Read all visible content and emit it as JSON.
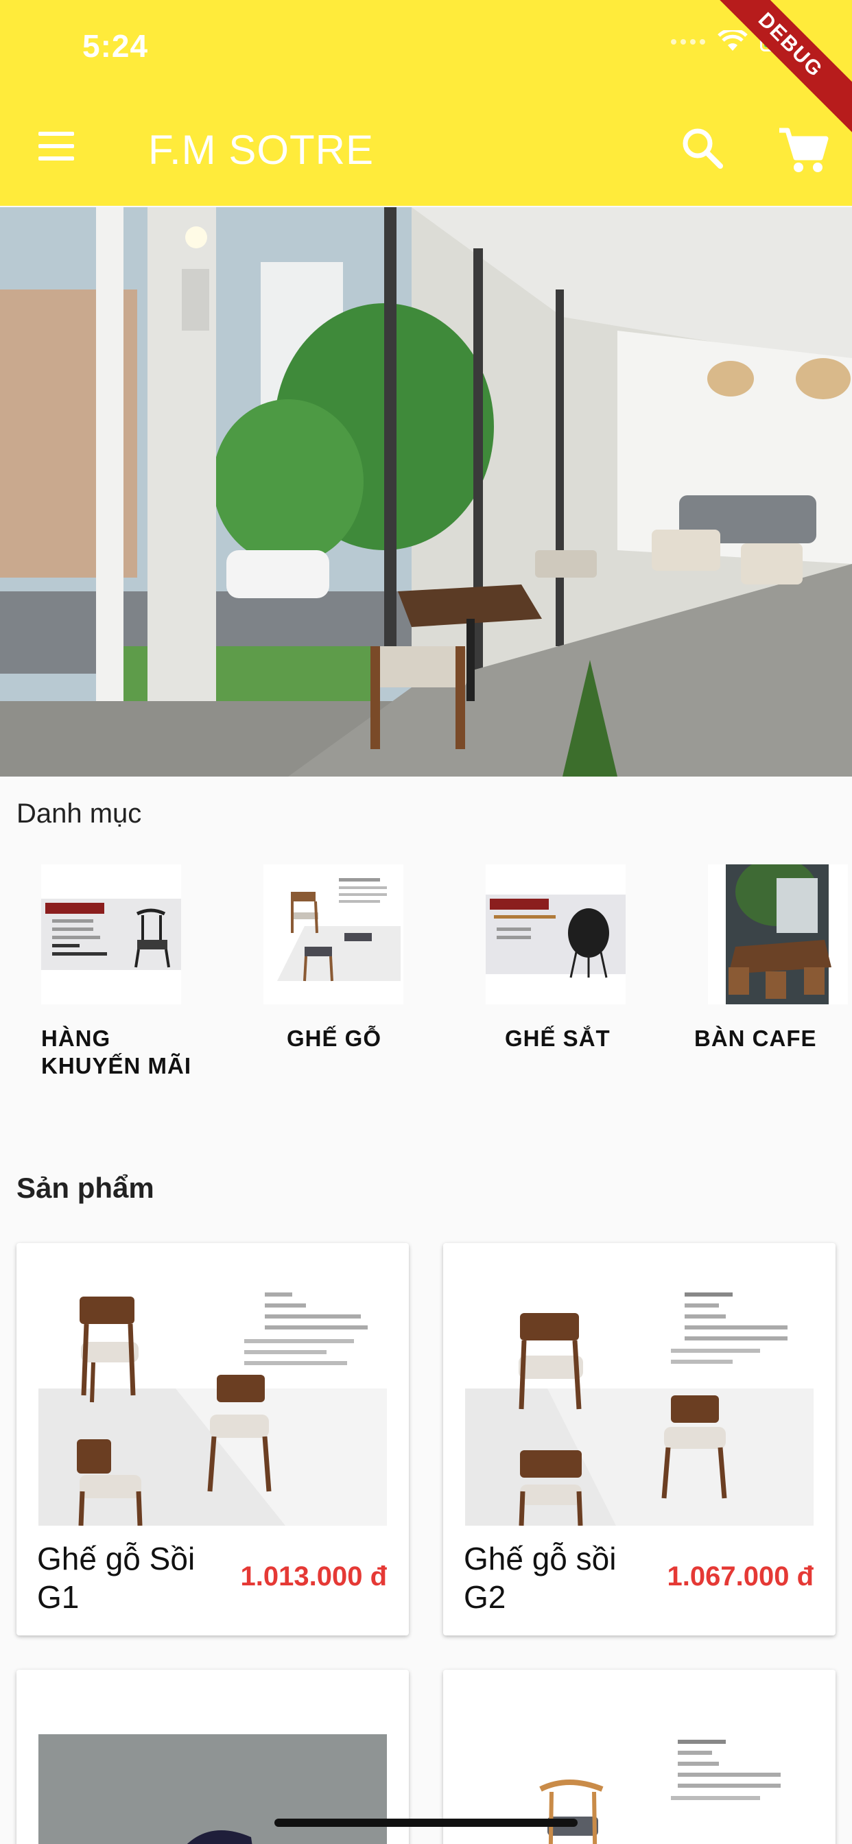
{
  "status_bar": {
    "time": "5:24",
    "debug_label": "DEBUG"
  },
  "appbar": {
    "title": "F.M SOTRE"
  },
  "sections": {
    "categories_title": "Danh mục",
    "products_title": "Sản phẩm"
  },
  "categories": [
    {
      "label": "HÀNG KHUYẾN MÃI"
    },
    {
      "label": "GHẾ GỖ"
    },
    {
      "label": "GHẾ SẮT"
    },
    {
      "label": "BÀN CAFE"
    }
  ],
  "products": [
    {
      "name": "Ghế gỗ Sồi G1",
      "price": "1.013.000 đ"
    },
    {
      "name": "Ghế gỗ sồi G2",
      "price": "1.067.000 đ"
    }
  ],
  "colors": {
    "appbar": "#ffeb3b",
    "price": "#e53935",
    "debug": "#b71c1c"
  }
}
